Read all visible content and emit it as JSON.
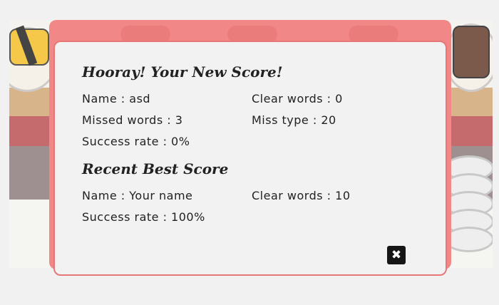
{
  "new_score": {
    "title": "Hooray! Your New Score!",
    "name_label": "Name : asd",
    "clear_words_label": "Clear words : 0",
    "missed_words_label": "Missed words : 3",
    "miss_type_label": "Miss type : 20",
    "success_rate_label": "Success rate : 0%"
  },
  "best_score": {
    "title": "Recent Best Score",
    "name_label": "Name : Your name",
    "clear_words_label": "Clear words : 10",
    "success_rate_label": "Success rate : 100%"
  },
  "close_glyph": "✖",
  "icons": {
    "close": "close-icon"
  },
  "colors": {
    "modal_border": "#e77777",
    "modal_back": "#f28787",
    "close_bg": "#151515"
  }
}
